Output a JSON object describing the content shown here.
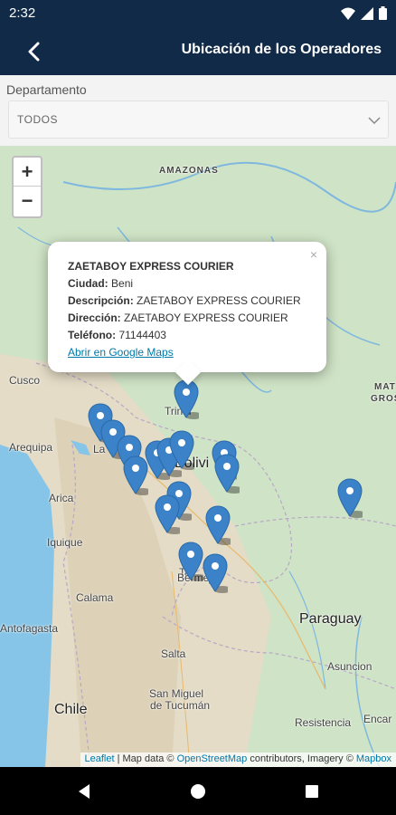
{
  "status_bar": {
    "time": "2:32"
  },
  "app_bar": {
    "title": "Ubicación de los Operadores"
  },
  "filter": {
    "label": "Departamento",
    "selected": "TODOS"
  },
  "map": {
    "labels": {
      "amazonas": "AMAZONAS",
      "mato_grosso_1": "MAT",
      "mato_grosso_2": "GROS",
      "cusco": "Cusco",
      "arequipa": "Arequipa",
      "arica": "Arica",
      "iquique": "Iquique",
      "calama": "Calama",
      "antofagasta": "Antofagasta",
      "chile": "Chile",
      "bolivia": "Bolivi",
      "trinidad": "Trinid",
      "la_paz": "La",
      "tarija": "Ta",
      "bermejo": "Bermejo",
      "salta": "Salta",
      "tucuman_1": "San Miguel",
      "tucuman_2": "de Tucumán",
      "paraguay": "Paraguay",
      "asuncion": "Asuncion",
      "resistencia": "Resistencia",
      "encarnacion": "Encar"
    },
    "colors": {
      "marker": "#3b82c8",
      "water": "#86c5e8",
      "land": "#c9dfc0",
      "popup_link": "#0078a8"
    },
    "popup": {
      "title": "ZAETABOY EXPRESS COURIER",
      "fields": [
        {
          "key": "Ciudad:",
          "value": "Beni"
        },
        {
          "key": "Descripción:",
          "value": "ZAETABOY EXPRESS COURIER"
        },
        {
          "key": "Dirección:",
          "value": "ZAETABOY EXPRESS COURIER"
        },
        {
          "key": "Teléfono:",
          "value": "71144403"
        }
      ],
      "link": "Abrir en Google Maps",
      "close": "×"
    },
    "zoom": {
      "in": "+",
      "out": "−"
    },
    "attribution": {
      "leaflet": "Leaflet",
      "text1": " | Map data © ",
      "osm": "OpenStreetMap",
      "text2": " contributors, Imagery © ",
      "mapbox": "Mapbox"
    }
  }
}
